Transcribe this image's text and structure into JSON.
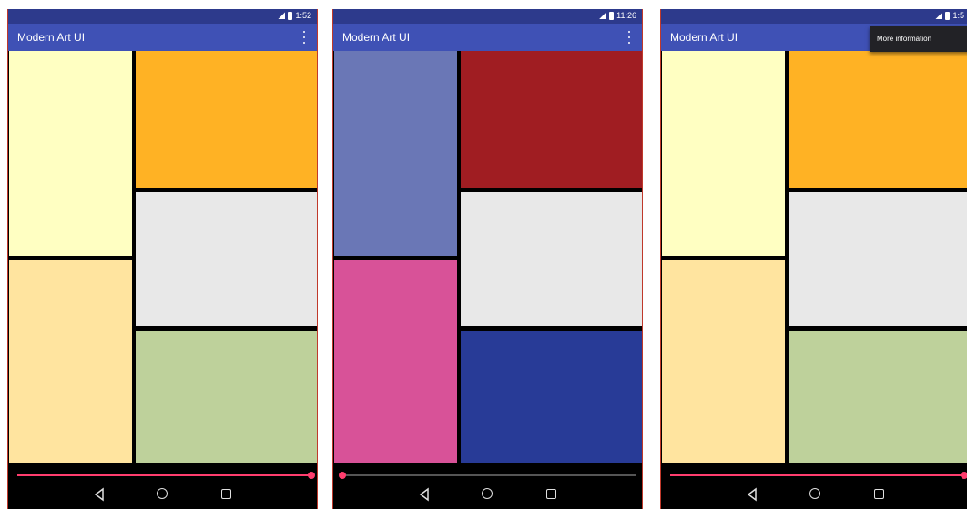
{
  "screens": [
    {
      "status_time": "1:52",
      "app_title": "Modern Art UI",
      "slider_fraction": 1.0,
      "colors": {
        "top_left": "#ffffc2",
        "bottom_left": "#ffe49f",
        "top_right": "#ffb224",
        "middle_right": "#e8e8e8",
        "bottom_right": "#bed19b"
      },
      "menu": null
    },
    {
      "status_time": "11:26",
      "app_title": "Modern Art UI",
      "slider_fraction": 0.0,
      "colors": {
        "top_left": "#6a77b6",
        "bottom_left": "#d85298",
        "top_right": "#a01d22",
        "middle_right": "#e8e8e8",
        "bottom_right": "#283b97"
      },
      "menu": null
    },
    {
      "status_time": "1:5",
      "app_title": "Modern Art UI",
      "slider_fraction": 1.0,
      "colors": {
        "top_left": "#ffffc2",
        "bottom_left": "#ffe49f",
        "top_right": "#ffb224",
        "middle_right": "#e8e8e8",
        "bottom_right": "#bed19b"
      },
      "menu": {
        "item_label": "More information"
      }
    }
  ],
  "icons": {
    "signal": "signal-icon",
    "battery": "battery-icon",
    "overflow": "more-vert-icon",
    "back": "back-icon",
    "home": "home-icon",
    "recents": "recents-icon"
  }
}
